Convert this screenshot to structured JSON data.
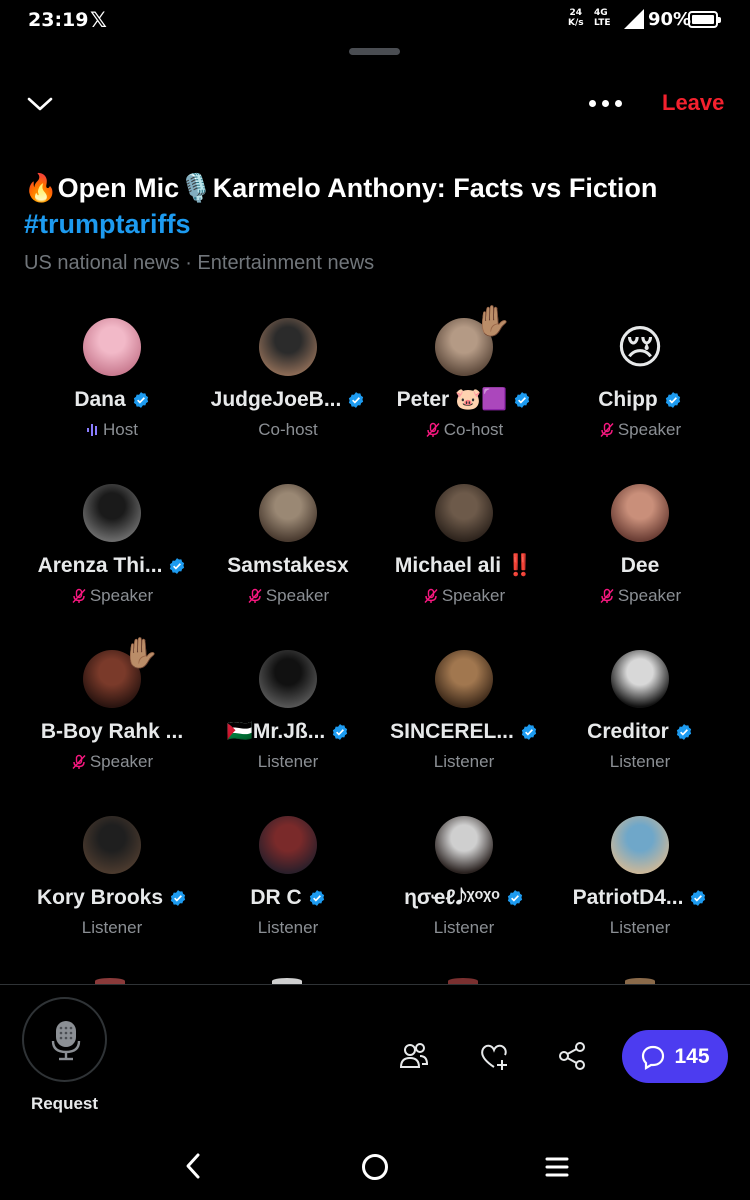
{
  "status_bar": {
    "time": "23:19",
    "app_logo": "𝕏",
    "net_speed_value": "24",
    "net_speed_unit": "K/s",
    "network": "4G",
    "network_sub": "LTE",
    "battery": "90%"
  },
  "header": {
    "leave_label": "Leave",
    "leave_color": "#f4212e"
  },
  "space": {
    "title": "🔥Open Mic🎙️Karmelo Anthony: Facts vs Fiction",
    "hashtag": "#trumptariffs",
    "topics": "US national news · Entertainment news"
  },
  "participants": [
    {
      "name": "Dana",
      "role": "Host",
      "verified": true,
      "mic": "speaking",
      "hand": false,
      "avatar_colors": [
        "#f2b9c8",
        "#c97b90"
      ]
    },
    {
      "name": "JudgeJoeB...",
      "role": "Co-host",
      "verified": true,
      "mic": "none",
      "hand": false,
      "avatar_colors": [
        "#2b2b2b",
        "#8a6a55"
      ]
    },
    {
      "name": "Peter 🐷🟪",
      "role": "Co-host",
      "verified": true,
      "mic": "muted",
      "hand": true,
      "avatar_colors": [
        "#b49a85",
        "#5e4a3c"
      ]
    },
    {
      "name": "Chipp",
      "role": "Speaker",
      "verified": true,
      "mic": "muted",
      "hand": false,
      "avatar_emoji": "😢"
    },
    {
      "name": "Arenza Thi...",
      "role": "Speaker",
      "verified": true,
      "mic": "muted",
      "hand": false,
      "avatar_colors": [
        "#1a1a1a",
        "#6b6b6b"
      ]
    },
    {
      "name": "Samstakesx",
      "role": "Speaker",
      "verified": false,
      "mic": "muted",
      "hand": false,
      "avatar_colors": [
        "#9a8874",
        "#4a3b30"
      ]
    },
    {
      "name": "Michael ali ‼️",
      "role": "Speaker",
      "verified": false,
      "mic": "muted",
      "hand": false,
      "avatar_colors": [
        "#6d5a4a",
        "#2e241d"
      ]
    },
    {
      "name": "Dee",
      "role": "Speaker",
      "verified": false,
      "mic": "muted",
      "hand": false,
      "avatar_colors": [
        "#c98f7a",
        "#6a3d34"
      ]
    },
    {
      "name": "B-Boy Rahk ...",
      "role": "Speaker",
      "verified": false,
      "mic": "muted",
      "hand": true,
      "avatar_colors": [
        "#7a3a2a",
        "#2a1410"
      ]
    },
    {
      "name": "🇵🇸Mr.Jß...",
      "role": "Listener",
      "verified": true,
      "mic": "none",
      "hand": false,
      "avatar_colors": [
        "#111111",
        "#555555"
      ]
    },
    {
      "name": "SINCEREL...",
      "role": "Listener",
      "verified": true,
      "mic": "none",
      "hand": false,
      "avatar_colors": [
        "#a1774f",
        "#3e2a1a"
      ]
    },
    {
      "name": "Creditor",
      "role": "Listener",
      "verified": true,
      "mic": "none",
      "hand": false,
      "avatar_colors": [
        "#d8d8d8",
        "#111111"
      ]
    },
    {
      "name": "Kory Brooks",
      "role": "Listener",
      "verified": true,
      "mic": "none",
      "hand": false,
      "avatar_colors": [
        "#1f1f1f",
        "#4b3a2e"
      ]
    },
    {
      "name": "DR C",
      "role": "Listener",
      "verified": true,
      "mic": "none",
      "hand": false,
      "avatar_colors": [
        "#7a2a2a",
        "#2b1f2a"
      ]
    },
    {
      "name": "ɳσҽℓ𝅘𝅥𝅮ᵡᵒᵡᵒ",
      "role": "Listener",
      "verified": true,
      "mic": "none",
      "hand": false,
      "avatar_colors": [
        "#cfcfcf",
        "#2a2220"
      ]
    },
    {
      "name": "PatriotD4...",
      "role": "Listener",
      "verified": true,
      "mic": "none",
      "hand": false,
      "avatar_colors": [
        "#6fa7c9",
        "#c9b79a"
      ]
    }
  ],
  "bottom": {
    "request_label": "Request",
    "comment_count": "145",
    "accent": "#4c3cf0"
  },
  "icons": {
    "collapse": "chevron-down-icon",
    "more": "more-dots-icon",
    "verified": "verified-badge-icon",
    "mic_off": "mic-off-icon",
    "speaking": "speaking-bars-icon",
    "hand": "raised-hand-icon",
    "microphone": "microphone-icon",
    "people": "people-icon",
    "heart_plus": "heart-plus-icon",
    "share": "share-icon",
    "comment": "comment-icon",
    "nav_back": "nav-back-icon",
    "nav_home": "nav-home-icon",
    "nav_menu": "nav-menu-icon"
  }
}
